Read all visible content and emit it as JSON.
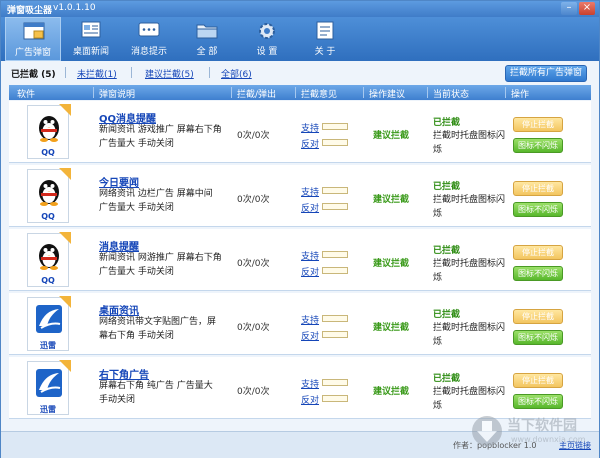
{
  "window": {
    "title": "弹窗吸尘器",
    "version": "v1.0.1.10",
    "min": "–",
    "close": "×"
  },
  "toolbar": [
    {
      "label": "广告弹窗",
      "icon": "popup-window-icon",
      "active": true
    },
    {
      "label": "桌面新闻",
      "icon": "desktop-news-icon",
      "active": false
    },
    {
      "label": "消息提示",
      "icon": "message-icon",
      "active": false
    },
    {
      "label": "全 部",
      "icon": "folder-icon",
      "active": false
    },
    {
      "label": "设 置",
      "icon": "gear-icon",
      "active": false
    },
    {
      "label": "关 于",
      "icon": "about-icon",
      "active": false
    }
  ],
  "filters": {
    "blocked": "已拦截 (5)",
    "unblocked": "未拦截(1)",
    "suggested": "建议拦截(5)",
    "all": "全部(6)"
  },
  "block_all_button": "拦截所有广告弹窗",
  "columns": {
    "software": "软件",
    "description": "弹窗说明",
    "count": "拦截/弹出",
    "opinion": "拦截意见",
    "suggestion": "操作建议",
    "status": "当前状态",
    "action": "操作"
  },
  "vote_labels": {
    "support": "支持",
    "oppose": "反对"
  },
  "rows": [
    {
      "software": "QQ",
      "kind": "qq",
      "title": "QQ消息提醒",
      "desc": "新闻资讯  游戏推广  屏幕右下角  广告量大  手动关闭",
      "count": "0次/0次",
      "suggestion": "建议拦截",
      "status": "已拦截",
      "status_detail": "拦截时托盘图标闪烁",
      "stop_button": "停止拦截",
      "flash_button": "图标不闪烁"
    },
    {
      "software": "QQ",
      "kind": "qq",
      "title": "今日要闻",
      "desc": "网络资讯  边栏广告  屏幕中间  广告量大  手动关闭",
      "count": "0次/0次",
      "suggestion": "建议拦截",
      "status": "已拦截",
      "status_detail": "拦截时托盘图标闪烁",
      "stop_button": "停止拦截",
      "flash_button": "图标不闪烁"
    },
    {
      "software": "QQ",
      "kind": "qq",
      "title": "消息提醒",
      "desc": "新闻资讯  网游推广  屏幕右下角  广告量大  手动关闭",
      "count": "0次/0次",
      "suggestion": "建议拦截",
      "status": "已拦截",
      "status_detail": "拦截时托盘图标闪烁",
      "stop_button": "停止拦截",
      "flash_button": "图标不闪烁"
    },
    {
      "software": "迅雷",
      "kind": "xunlei",
      "title": "桌面资讯",
      "desc": "网络资讯带文字贴图广告，屏幕右下角  手动关闭",
      "count": "0次/0次",
      "suggestion": "建议拦截",
      "status": "已拦截",
      "status_detail": "拦截时托盘图标闪烁",
      "stop_button": "停止拦截",
      "flash_button": "图标不闪烁"
    },
    {
      "software": "迅雷",
      "kind": "xunlei",
      "title": "右下角广告",
      "desc": "屏幕右下角  纯广告  广告量大  手动关闭",
      "count": "0次/0次",
      "suggestion": "建议拦截",
      "status": "已拦截",
      "status_detail": "拦截时托盘图标闪烁",
      "stop_button": "停止拦截",
      "flash_button": "图标不闪烁"
    }
  ],
  "footer": {
    "author": "作者：popblocker 1.0",
    "home": "主页链接"
  },
  "watermark": {
    "text": "当下软件园",
    "url": "www.downxia.com"
  },
  "colors": {
    "titlebar": "#3f7cc8",
    "accent": "#2f78cf",
    "status_green": "#2d8c12",
    "link_blue": "#1546b8"
  }
}
